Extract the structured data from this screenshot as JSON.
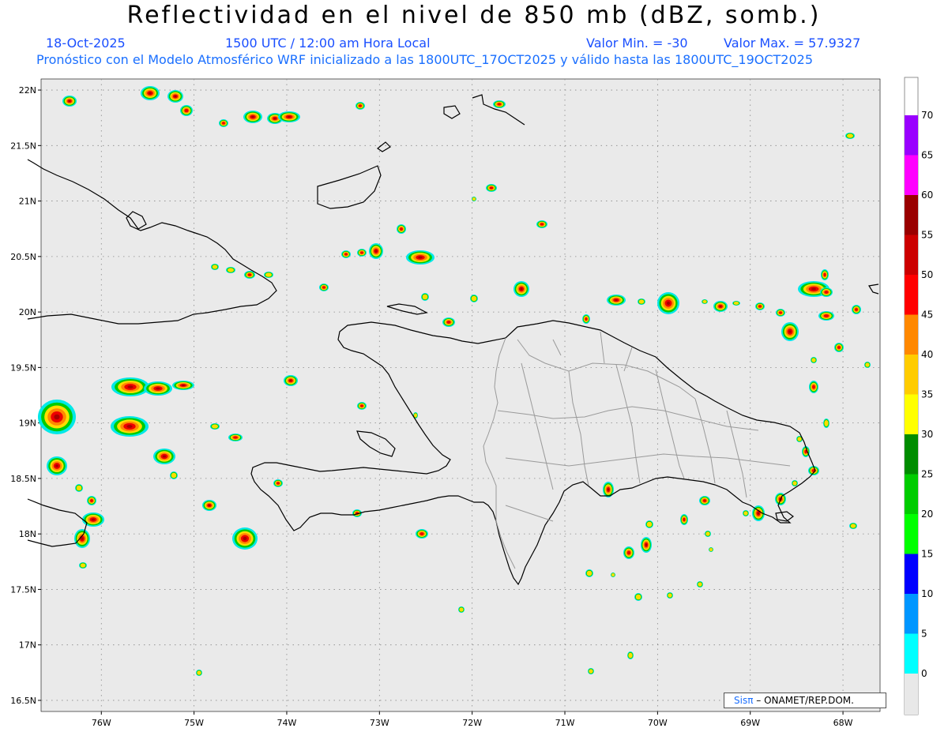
{
  "header": {
    "title": "Reflectividad en el nivel de 850 mb (dBZ, somb.)",
    "date": "18-Oct-2025",
    "time": "1500 UTC / 12:00 am Hora Local",
    "value_min": "Valor Min. = -30",
    "value_max": "Valor Max. = 57.9327",
    "description": "Pronóstico con el Modelo Atmosférico WRF inicializado a las 1800UTC_17OCT2025 y válido hasta las  1800UTC_19OCT2025"
  },
  "map": {
    "lat_labels": [
      "22N",
      "21.5N",
      "21N",
      "20.5N",
      "20N",
      "19.5N",
      "19N",
      "18.5N",
      "18N",
      "17.5N",
      "17N",
      "16.5N"
    ],
    "lon_labels": [
      "76W",
      "75W",
      "74W",
      "73W",
      "72W",
      "71W",
      "70W",
      "69W",
      "68W"
    ],
    "lat_values": [
      22,
      21.5,
      21,
      20.5,
      20,
      19.5,
      19,
      18.5,
      18,
      17.5,
      17,
      16.5
    ],
    "lon_values": [
      -76,
      -75,
      -74,
      -73,
      -72,
      -71,
      -70,
      -69,
      -68
    ],
    "lon_range": [
      -76.65,
      -67.6
    ],
    "lat_range": [
      16.4,
      22.1
    ],
    "background_color": "#eaeaea"
  },
  "colorbar": {
    "labels": [
      "0",
      "5",
      "10",
      "15",
      "20",
      "25",
      "30",
      "35",
      "40",
      "45",
      "50",
      "55",
      "60",
      "65",
      "70"
    ],
    "colors": [
      "#00ffff",
      "#0096ff",
      "#0000ff",
      "#00ff00",
      "#00cc00",
      "#008c00",
      "#ffff00",
      "#ffcc00",
      "#ff8800",
      "#ff0000",
      "#cc0000",
      "#990000",
      "#ff00ff",
      "#9900ff"
    ]
  },
  "credit": {
    "brand": "Sisπ",
    "org": " – ONAMET/REP.DOM."
  }
}
